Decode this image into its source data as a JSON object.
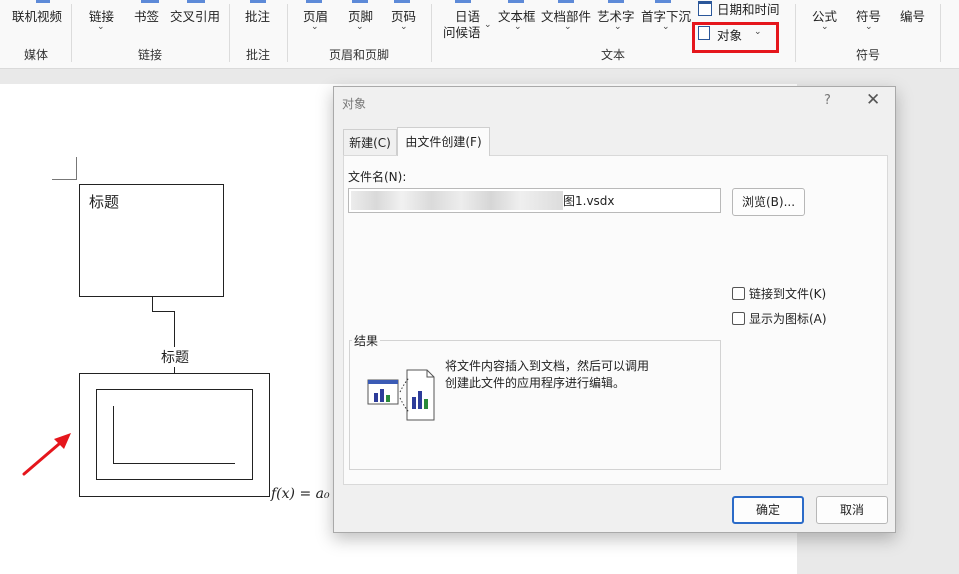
{
  "ribbon": {
    "items": {
      "online_video": "联机视频",
      "link": "链接",
      "bookmark": "书签",
      "cross_ref": "交叉引用",
      "comment": "批注",
      "header": "页眉",
      "footer": "页脚",
      "page_number": "页码",
      "japanese_greeting_l1": "日语",
      "japanese_greeting_l2": "问候语",
      "textbox": "文本框",
      "quick_parts": "文档部件",
      "wordart": "艺术字",
      "dropcap": "首字下沉",
      "datetime": "日期和时间",
      "object": "对象",
      "equation": "公式",
      "symbol": "符号",
      "numbering": "编号"
    },
    "groups": {
      "media": "媒体",
      "links": "链接",
      "comments": "批注",
      "header_footer": "页眉和页脚",
      "text": "文本",
      "symbols": "符号"
    }
  },
  "document": {
    "box_title": "标题",
    "connector_label": "标题",
    "formula": "f(x) = a₀"
  },
  "dialog": {
    "title": "对象",
    "help": "?",
    "close": "✕",
    "tabs": [
      "新建(C)",
      "由文件创建(F)"
    ],
    "file_name_label": "文件名(N):",
    "file_name_value": "图1.vsdx",
    "browse_button": "浏览(B)...",
    "link_to_file": "链接到文件(K)",
    "display_as_icon": "显示为图标(A)",
    "result_label": "结果",
    "result_text": "将文件内容插入到文档，然后可以调用创建此文件的应用程序进行编辑。",
    "ok_button": "确定",
    "cancel_button": "取消"
  },
  "colors": {
    "highlight": "#e5161c",
    "arrow": "#e5161c",
    "accent": "#2b6bc8"
  }
}
